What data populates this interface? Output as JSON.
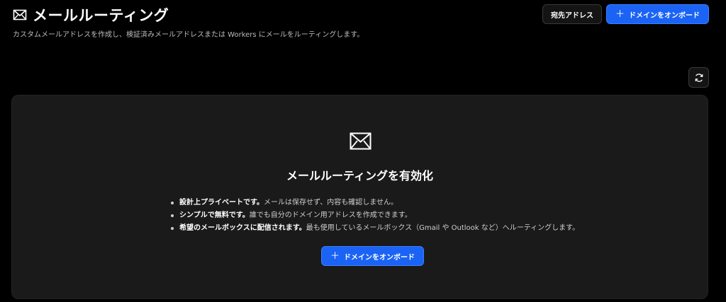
{
  "header": {
    "title": "メールルーティング",
    "subtitle": "カスタムメールアドレスを作成し、検証済みメールアドレスまたは Workers にメールをルーティングします。"
  },
  "actions": {
    "destination_label": "宛先アドレス",
    "onboard_label": "ドメインをオンボード"
  },
  "card": {
    "title": "メールルーティングを有効化",
    "features": [
      {
        "bold": "設計上プライベートです。",
        "text": "メールは保存せず、内容も確認しません。"
      },
      {
        "bold": "シンプルで無料です。",
        "text": "誰でも自分のドメイン用アドレスを作成できます。"
      },
      {
        "bold": "希望のメールボックスに配信されます。",
        "text": "最も使用しているメールボックス（Gmail や Outlook など）へルーティングします。"
      }
    ],
    "onboard_label": "ドメインをオンボード"
  },
  "colors": {
    "background": "#000000",
    "card": "#1a1a1b",
    "primary": "#1a63f5"
  },
  "icons": {
    "title": "mail-icon",
    "refresh": "refresh-icon",
    "card": "mail-icon",
    "plus": "plus-icon"
  }
}
